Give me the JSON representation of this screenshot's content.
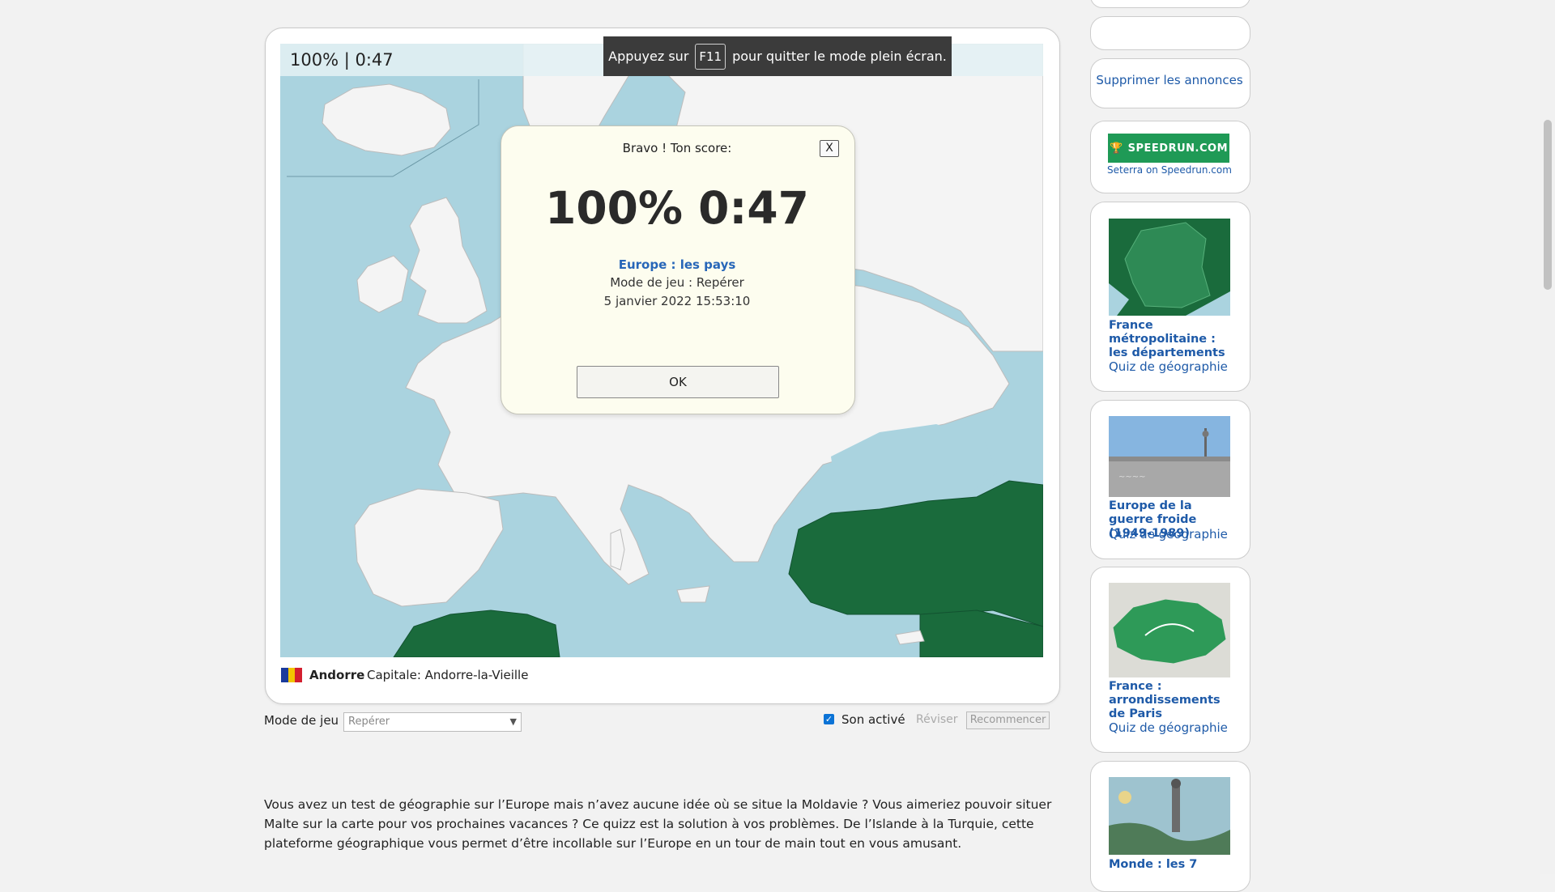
{
  "toast": {
    "before": "Appuyez sur",
    "key": "F11",
    "after": "pour quitter le mode plein écran."
  },
  "game": {
    "score_display": "100% | 0:47",
    "map_colors": {
      "sea": "#aad3df",
      "land": "#f4f4f4",
      "done": "#1a6b3c",
      "border": "#bcbcbc"
    }
  },
  "modal": {
    "heading": "Bravo ! Ton score:",
    "close_label": "X",
    "score": "100% 0:47",
    "quiz_title": "Europe : les pays",
    "mode_text": "Mode de jeu : Repérer",
    "date_text": "5 janvier 2022  15:53:10",
    "ok_label": "OK"
  },
  "current_country": {
    "name": "Andorre",
    "capital": "Capitale: Andorre-la-Vieille",
    "flag_colors": [
      "#1a3a9c",
      "#f2c500",
      "#d31f2f"
    ]
  },
  "controls": {
    "mode_label": "Mode de jeu :",
    "mode_value": "Repérer",
    "sound_label": "Son activé",
    "sound_checked": true,
    "review_label": "Réviser",
    "restart_label": "Recommencer"
  },
  "description": "Vous avez un test de géographie sur l’Europe mais n’avez aucune idée où se situe la Moldavie ? Vous aimeriez pouvoir situer Malte sur la carte pour vos prochaines vacances ? Ce quizz est la solution à vos problèmes. De l’Islande à la Turquie, cette plateforme géographique vous permet d’être incollable sur l’Europe en un tour de main tout en vous amusant.",
  "sidebar": {
    "remove_ads": "Supprimer les annonces",
    "speedrun_logo": "SPEEDRUN.COM",
    "speedrun_text": "Seterra on Speedrun.com",
    "related": [
      {
        "title": "France métropolitaine : les départements",
        "subtitle": "Quiz de géographie"
      },
      {
        "title": "Europe de la guerre froide (1949-1989)",
        "subtitle": "Quiz de géographie"
      },
      {
        "title": "France : arrondissements de Paris",
        "subtitle": "Quiz de géographie"
      },
      {
        "title": "Monde : les 7",
        "subtitle": ""
      }
    ]
  }
}
